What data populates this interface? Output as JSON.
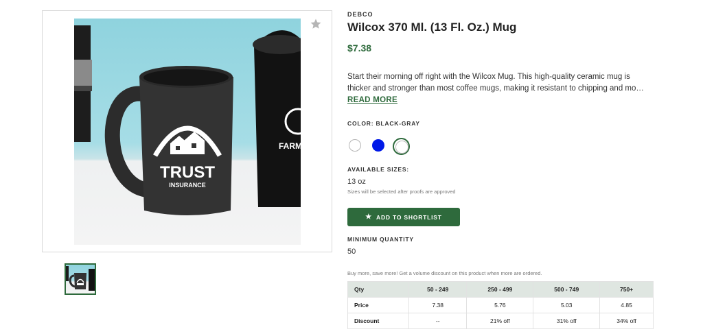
{
  "gallery": {
    "main_image_alt": "Black mug with TRUST INSURANCE logo",
    "logo_text": "TRUST",
    "logo_subtext": "INSURANCE",
    "second_mug_text": "FARM",
    "favorite_icon": "star-icon"
  },
  "product": {
    "brand": "DEBCO",
    "title": "Wilcox 370 Ml. (13 Fl. Oz.) Mug",
    "price": "$7.38",
    "description_line1": "Start their morning off right with the Wilcox Mug. This high-quality ceramic mug is",
    "description_line2": "thicker and stronger than most coffee mugs, making it resistant to chipping and mo…",
    "read_more": "READ MORE"
  },
  "color": {
    "label": "COLOR: BLACK-GRAY",
    "swatches": [
      {
        "name": "white",
        "hex": "#ffffff"
      },
      {
        "name": "blue",
        "hex": "#0019e8"
      },
      {
        "name": "black-gray",
        "hex": "#ffffff",
        "selected": true
      }
    ]
  },
  "sizes": {
    "label": "AVAILABLE SIZES:",
    "value": "13 oz",
    "note": "Sizes will be selected after proofs are approved"
  },
  "actions": {
    "shortlist_label": "ADD TO SHORTLIST",
    "shortlist_icon": "star-icon"
  },
  "minimum_quantity": {
    "label": "MINIMUM QUANTITY",
    "value": "50"
  },
  "pricing": {
    "note": "Buy more, save more! Get a volume discount on this product when more are ordered.",
    "header": [
      "Qty",
      "50 - 249",
      "250 - 499",
      "500 - 749",
      "750+"
    ],
    "price_row": [
      "Price",
      "7.38",
      "5.76",
      "5.03",
      "4.85"
    ],
    "discount_row": [
      "Discount",
      "--",
      "21% off",
      "31% off",
      "34% off"
    ]
  },
  "colors": {
    "accent": "#2e6a3c",
    "table_header_bg": "#dfe6e1"
  }
}
